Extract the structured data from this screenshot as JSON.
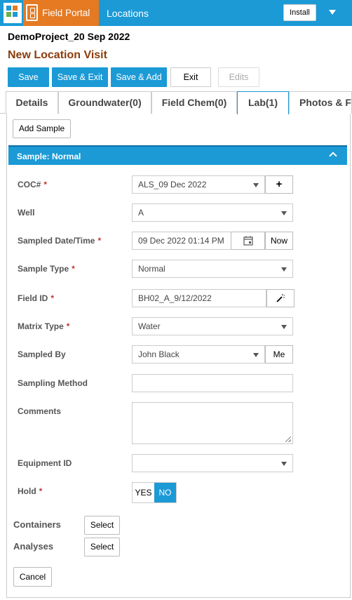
{
  "header": {
    "brand": "Field Portal",
    "nav_locations": "Locations",
    "install_label": "Install",
    "colors": {
      "accent": "#1b9ad6",
      "brand": "#e57a22",
      "title": "#8b3c0a"
    }
  },
  "project_title": "DemoProject_20 Sep 2022",
  "page_title": "New Location Visit",
  "toolbar": {
    "save": "Save",
    "save_exit": "Save & Exit",
    "save_add": "Save & Add",
    "exit": "Exit",
    "edits": "Edits"
  },
  "tabs": [
    {
      "label": "Details",
      "active": false
    },
    {
      "label": "Groundwater(0)",
      "active": false
    },
    {
      "label": "Field Chem(0)",
      "active": false
    },
    {
      "label": "Lab(1)",
      "active": true
    },
    {
      "label": "Photos & Fi",
      "active": false
    }
  ],
  "add_sample": "Add Sample",
  "section": {
    "title": "Sample: Normal",
    "icon": "chevron-up-icon"
  },
  "form": {
    "coc": {
      "label": "COC#",
      "value": "ALS_09 Dec 2022",
      "addon": "+"
    },
    "well": {
      "label": "Well",
      "value": "A"
    },
    "sampled_datetime": {
      "label": "Sampled Date/Time",
      "value": "09 Dec 2022 01:14 PM",
      "addon": "Now"
    },
    "sample_type": {
      "label": "Sample Type",
      "value": "Normal"
    },
    "field_id": {
      "label": "Field ID",
      "value": "BH02_A_9/12/2022"
    },
    "matrix_type": {
      "label": "Matrix Type",
      "value": "Water"
    },
    "sampled_by": {
      "label": "Sampled By",
      "value": "John Black",
      "addon": "Me"
    },
    "sampling_method": {
      "label": "Sampling Method",
      "value": ""
    },
    "comments": {
      "label": "Comments",
      "value": ""
    },
    "equipment_id": {
      "label": "Equipment ID",
      "value": ""
    },
    "hold": {
      "label": "Hold",
      "yes": "YES",
      "no": "NO",
      "selected": "NO"
    }
  },
  "required_mark": "*",
  "containers": {
    "label": "Containers",
    "button": "Select"
  },
  "analyses": {
    "label": "Analyses",
    "button": "Select"
  },
  "cancel": "Cancel"
}
